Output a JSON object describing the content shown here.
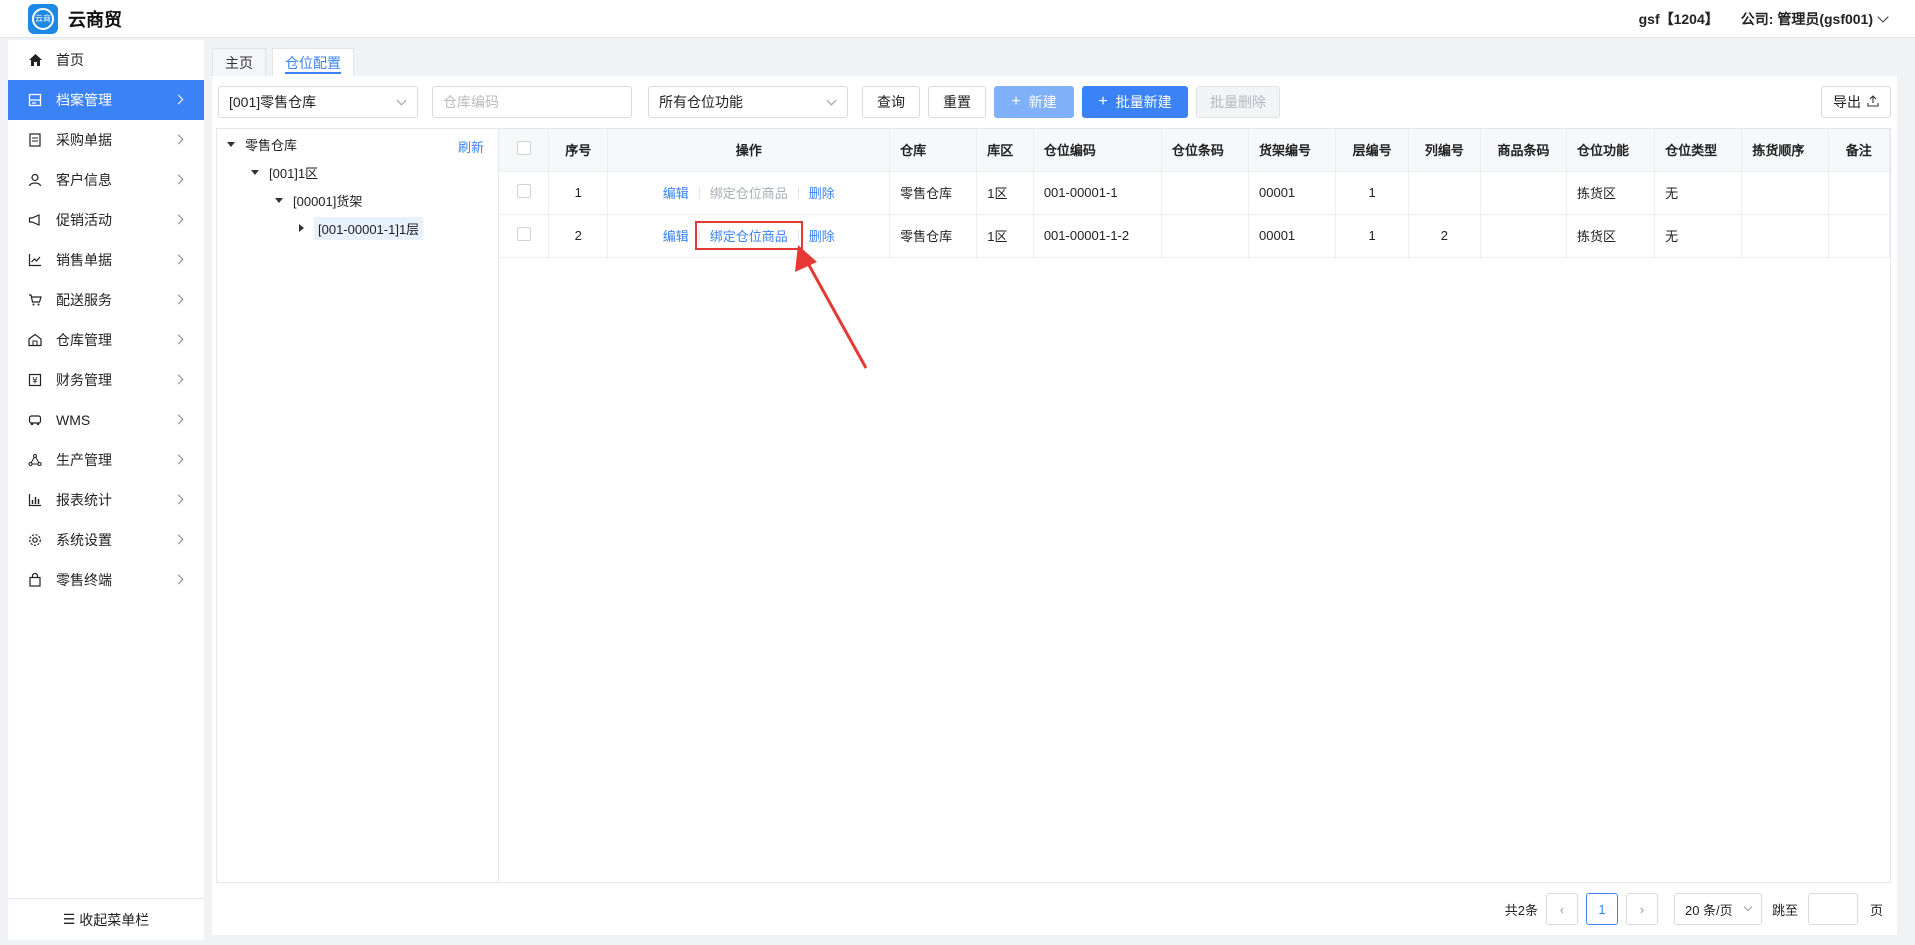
{
  "header": {
    "app_title": "云商贸",
    "logo_text": "云商",
    "user": "gsf【1204】",
    "company": "公司: 管理员(gsf001)"
  },
  "sidebar": {
    "items": [
      {
        "label": "首页",
        "icon": "home-icon"
      },
      {
        "label": "档案管理",
        "icon": "archive-icon"
      },
      {
        "label": "采购单据",
        "icon": "purchase-icon"
      },
      {
        "label": "客户信息",
        "icon": "user-icon"
      },
      {
        "label": "促销活动",
        "icon": "megaphone-icon"
      },
      {
        "label": "销售单据",
        "icon": "sales-chart-icon"
      },
      {
        "label": "配送服务",
        "icon": "cart-icon"
      },
      {
        "label": "仓库管理",
        "icon": "warehouse-icon"
      },
      {
        "label": "财务管理",
        "icon": "finance-icon"
      },
      {
        "label": "WMS",
        "icon": "truck-icon"
      },
      {
        "label": "生产管理",
        "icon": "network-icon"
      },
      {
        "label": "报表统计",
        "icon": "bar-chart-icon"
      },
      {
        "label": "系统设置",
        "icon": "gear-icon"
      },
      {
        "label": "零售终端",
        "icon": "bag-icon"
      }
    ],
    "collapse_label": "收起菜单栏"
  },
  "tabs": [
    {
      "label": "主页",
      "active": false
    },
    {
      "label": "仓位配置",
      "active": true
    }
  ],
  "toolbar": {
    "warehouse_select": "[001]零售仓库",
    "code_placeholder": "仓库编码",
    "function_select": "所有仓位功能",
    "query": "查询",
    "reset": "重置",
    "new": "新建",
    "batch_new": "批量新建",
    "batch_delete": "批量删除",
    "export": "导出"
  },
  "tree": {
    "refresh": "刷新",
    "nodes": [
      {
        "label": "零售仓库"
      },
      {
        "label": "[001]1区"
      },
      {
        "label": "[00001]货架"
      },
      {
        "label": "[001-00001-1]1层"
      }
    ]
  },
  "table": {
    "headers": [
      "",
      "序号",
      "操作",
      "仓库",
      "库区",
      "仓位编码",
      "仓位条码",
      "货架编号",
      "层编号",
      "列编号",
      "商品条码",
      "仓位功能",
      "仓位类型",
      "拣货顺序",
      "备注"
    ],
    "op_labels": {
      "edit": "编辑",
      "bind": "绑定仓位商品",
      "delete": "删除"
    },
    "rows": [
      {
        "idx": "1",
        "warehouse": "零售仓库",
        "zone": "1区",
        "code": "001-00001-1",
        "barcode": "",
        "shelf": "00001",
        "layer": "1",
        "column": "",
        "goods": "",
        "func": "拣货区",
        "type": "无",
        "order": "",
        "remark": ""
      },
      {
        "idx": "2",
        "warehouse": "零售仓库",
        "zone": "1区",
        "code": "001-00001-1-2",
        "barcode": "",
        "shelf": "00001",
        "layer": "1",
        "column": "2",
        "goods": "",
        "func": "拣货区",
        "type": "无",
        "order": "",
        "remark": ""
      }
    ]
  },
  "pager": {
    "total": "共2条",
    "current": "1",
    "page_size": "20 条/页",
    "jump_label": "跳至",
    "page_suffix": "页"
  },
  "annotation_color": "#e53935"
}
